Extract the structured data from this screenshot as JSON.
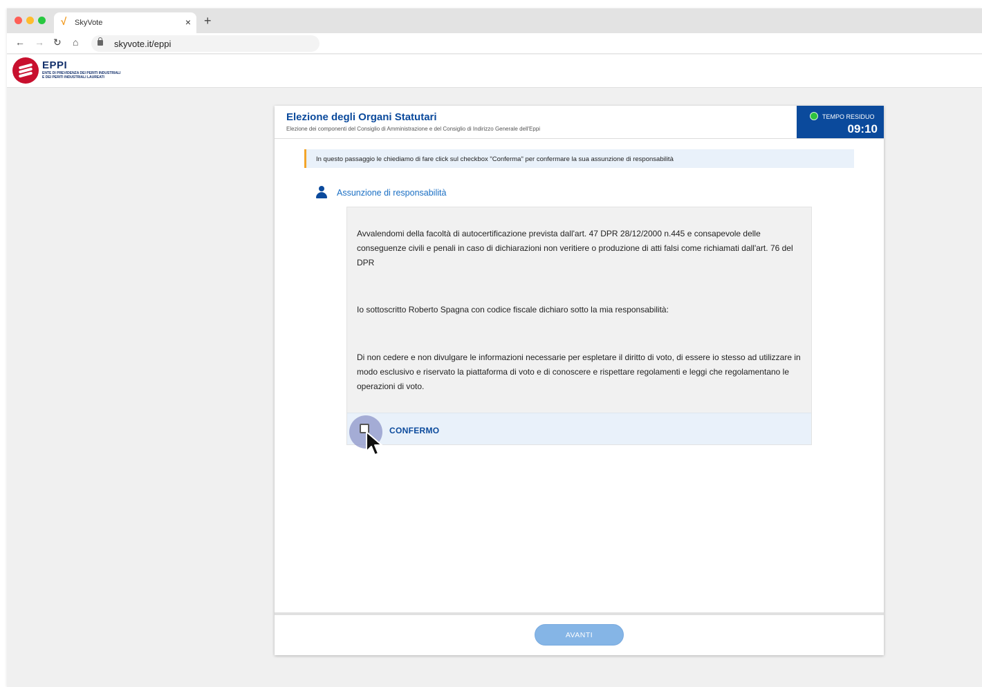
{
  "browser": {
    "tab_title": "SkyVote",
    "tab_favicon": "√",
    "tab_close": "×",
    "new_tab": "+",
    "url": "skyvote.it/eppi",
    "nav": {
      "back": "←",
      "forward": "→",
      "reload": "↻",
      "home": "⌂"
    }
  },
  "site": {
    "logo_name": "EPPI",
    "logo_sub": "ENTE DI PREVIDENZA DEI PERITI INDUSTRIALI E DEI PERITI INDUSTRIALI LAUREATI",
    "brand_color": "#c8102e"
  },
  "card": {
    "title": "Elezione degli Organi Statutari",
    "subtitle": "Elezione dei componenti del Consiglio di Amministrazione e del Consiglio di Indirizzo Generale dell'Eppi",
    "accent_color": "#0b4a9c"
  },
  "timer": {
    "label": "TEMPO RESIDUO",
    "value": "09:10"
  },
  "notice": {
    "text": "In questo passaggio le chiediamo di fare click sul checkbox \"Conferma\" per confermare la sua assunzione di responsabilità"
  },
  "section": {
    "icon": "user-icon",
    "title": "Assunzione di responsabilità"
  },
  "declaration": {
    "paragraphs": [
      "Avvalendomi della facoltà di autocertificazione prevista dall'art. 47 DPR 28/12/2000 n.445 e consapevole delle conseguenze civili e penali in caso di dichiarazioni non veritiere o produzione di atti falsi come richiamati dall'art. 76 del DPR",
      "Io sottoscritto Roberto Spagna con codice fiscale dichiaro sotto la mia responsabilità:",
      "Di non cedere e non divulgare le informazioni necessarie per espletare il diritto di voto, di essere io stesso ad utilizzare in modo esclusivo e riservato la piattaforma di voto e di conoscere e rispettare regolamenti e leggi che regolamentano le operazioni di voto."
    ],
    "confirm_label": "CONFERMO",
    "confirm_checked": false
  },
  "footer": {
    "next_label": "AVANTI"
  }
}
